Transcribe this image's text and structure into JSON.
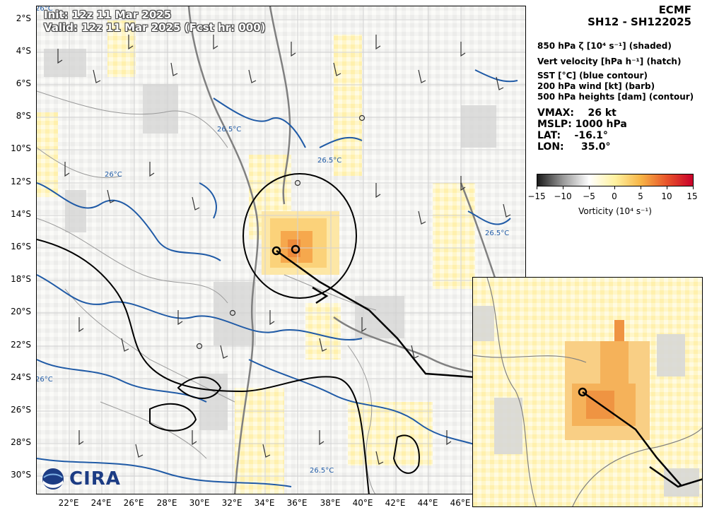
{
  "header": {
    "init_label": "Init:   12z 11 Mar 2025",
    "valid_label": "Valid: 12z 11 Mar 2025 (Fcst hr: 000)"
  },
  "panel": {
    "model": "ECMF",
    "storm": "SH12 - SH122025",
    "fields": [
      "850 hPa ζ [10⁴ s⁻¹] (shaded)",
      "Vert velocity [hPa h⁻¹] (hatch)",
      "SST [°C] (blue contour)",
      "200 hPa wind [kt] (barb)",
      "500 hPa heights [dam] (contour)"
    ],
    "stats": [
      "VMAX:    26 kt",
      "MSLP: 1000 hPa",
      "LAT:    -16.1°",
      "LON:     35.0°"
    ]
  },
  "colorbar": {
    "ticks": [
      "−15",
      "−10",
      "−5",
      "0",
      "5",
      "10",
      "15"
    ],
    "label": "Vorticity (10⁴ s⁻¹)",
    "range": [
      -15,
      15
    ],
    "colors": [
      "#1a1a1a",
      "#9a9a9a",
      "#ffffff",
      "#fff2a0",
      "#f7b445",
      "#e8532a",
      "#c9002b"
    ]
  },
  "axes": {
    "lat_ticks": [
      "2°S",
      "4°S",
      "6°S",
      "8°S",
      "10°S",
      "12°S",
      "14°S",
      "16°S",
      "18°S",
      "20°S",
      "22°S",
      "24°S",
      "26°S",
      "28°S",
      "30°S"
    ],
    "lon_ticks": [
      "22°E",
      "24°E",
      "26°E",
      "28°E",
      "30°E",
      "32°E",
      "34°E",
      "36°E",
      "38°E",
      "40°E",
      "42°E",
      "44°E",
      "46°E"
    ]
  },
  "map": {
    "sst_labels": [
      "26°C",
      "26.5°C",
      "26.5°C",
      "26°C",
      "26°C",
      "26.5°C",
      "26.5°C"
    ],
    "sst_color": "#1f5aa6",
    "track_color": "#000000",
    "storm_center": {
      "lat": -16.1,
      "lon": 35.0
    }
  },
  "logo": {
    "text": "CIRA",
    "agency_icon": "noaa-logo-icon"
  }
}
